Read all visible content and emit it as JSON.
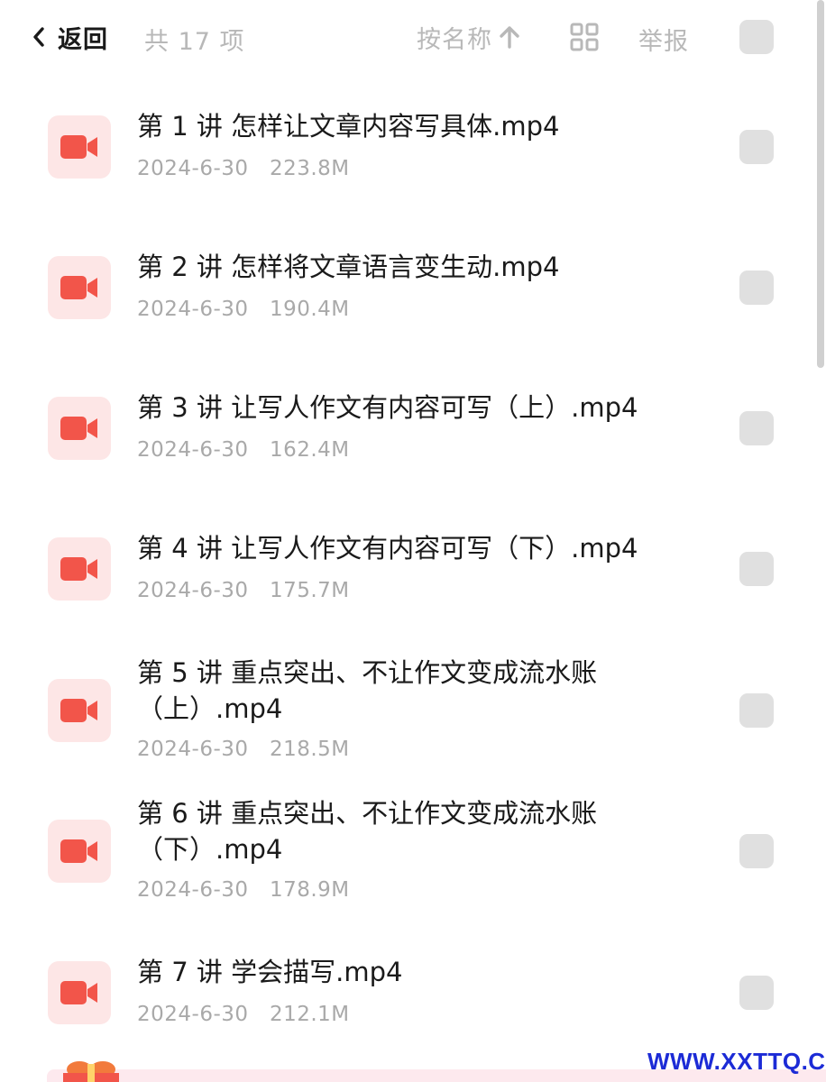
{
  "header": {
    "back_label": "返回",
    "count_label": "共 17 项",
    "sort_label": "按名称",
    "report_label": "举报",
    "icons": {
      "back": "chevron-left-icon",
      "sort": "arrow-up-icon",
      "view": "grid-view-icon"
    }
  },
  "files": [
    {
      "name": "第 1 讲 怎样让文章内容写具体.mp4",
      "meta": "2024-6-30   223.8M"
    },
    {
      "name": "第 2 讲 怎样将文章语言变生动.mp4",
      "meta": "2024-6-30   190.4M"
    },
    {
      "name": "第 3 讲 让写人作文有内容可写（上）.mp4",
      "meta": "2024-6-30   162.4M"
    },
    {
      "name": "第 4 讲 让写人作文有内容可写（下）.mp4",
      "meta": "2024-6-30   175.7M"
    },
    {
      "name": "第 5 讲 重点突出、不让作文变成流水账（上）.mp4",
      "meta": "2024-6-30   218.5M"
    },
    {
      "name": "第 6 讲 重点突出、不让作文变成流水账（下）.mp4",
      "meta": "2024-6-30   178.9M"
    },
    {
      "name": "第 7 讲 学会描写.mp4",
      "meta": "2024-6-30   212.1M"
    }
  ],
  "watermark": "WWW.XXTTQ.COM",
  "colors": {
    "video_icon": "#f2554a",
    "video_icon_bg": "#fde6e6",
    "checkbox": "#e0e0e0",
    "muted_text": "#b8b8b8",
    "watermark": "#1c2bd6"
  }
}
